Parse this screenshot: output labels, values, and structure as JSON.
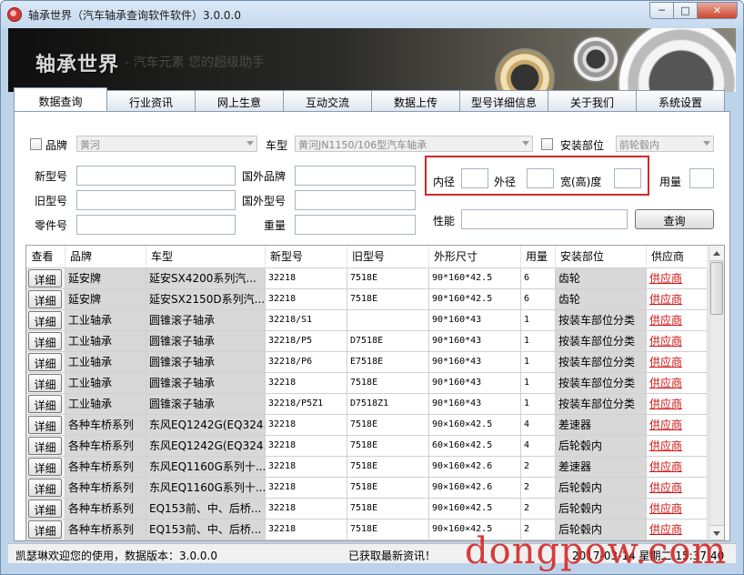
{
  "window": {
    "title": "轴承世界（汽车轴承查询软件软件）3.0.0.0",
    "min_glyph": "─",
    "max_glyph": "□",
    "close_glyph": "✕"
  },
  "banner": {
    "brand": "轴承世界",
    "slogan": "- 汽车元素 您的超级助手"
  },
  "tabs": [
    "数据查询",
    "行业资讯",
    "网上生意",
    "互动交流",
    "数据上传",
    "型号详细信息",
    "关于我们",
    "系统设置"
  ],
  "filters": {
    "brand_label": "品牌",
    "brand_value": "黄河",
    "car_label": "车型",
    "car_value": "黄河JN1150/106型汽车轴承",
    "install_label": "安装部位",
    "install_value": "前轮毂内",
    "new_model_label": "新型号",
    "old_model_label": "旧型号",
    "part_no_label": "零件号",
    "foreign_brand_label": "国外品牌",
    "foreign_model_label": "国外型号",
    "weight_label": "重量",
    "inner_label": "内径",
    "outer_label": "外径",
    "width_label": "宽(高)度",
    "usage_label": "用量",
    "perf_label": "性能",
    "query_button": "查询"
  },
  "grid": {
    "columns": [
      "查看",
      "品牌",
      "车型",
      "新型号",
      "旧型号",
      "外形尺寸",
      "用量",
      "安装部位",
      "供应商"
    ],
    "detail_label": "详细",
    "rows": [
      {
        "brand": "延安牌",
        "car": "延安SX4200系列汽...",
        "new": "32218",
        "old": "7518E",
        "size": "90*160*42.5",
        "qty": "6",
        "pos": "齿轮",
        "vendor": "供应商"
      },
      {
        "brand": "延安牌",
        "car": "延安SX2150D系列汽...",
        "new": "32218",
        "old": "7518E",
        "size": "90*160*42.5",
        "qty": "6",
        "pos": "齿轮",
        "vendor": "供应商"
      },
      {
        "brand": "工业轴承",
        "car": "圆锥滚子轴承",
        "new": "32218/S1",
        "old": "",
        "size": "90*160*43",
        "qty": "1",
        "pos": "按装车部位分类",
        "vendor": "供应商"
      },
      {
        "brand": "工业轴承",
        "car": "圆锥滚子轴承",
        "new": "32218/P5",
        "old": "D7518E",
        "size": "90*160*43",
        "qty": "1",
        "pos": "按装车部位分类",
        "vendor": "供应商"
      },
      {
        "brand": "工业轴承",
        "car": "圆锥滚子轴承",
        "new": "32218/P6",
        "old": "E7518E",
        "size": "90*160*43",
        "qty": "1",
        "pos": "按装车部位分类",
        "vendor": "供应商"
      },
      {
        "brand": "工业轴承",
        "car": "圆锥滚子轴承",
        "new": "32218",
        "old": "7518E",
        "size": "90*160*43",
        "qty": "1",
        "pos": "按装车部位分类",
        "vendor": "供应商"
      },
      {
        "brand": "工业轴承",
        "car": "圆锥滚子轴承",
        "new": "32218/P5Z1",
        "old": "D7518Z1",
        "size": "90*160*43",
        "qty": "1",
        "pos": "按装车部位分类",
        "vendor": "供应商"
      },
      {
        "brand": "各种车桥系列",
        "car": "东风EQ1242G(EQ324...",
        "new": "32218",
        "old": "7518E",
        "size": "90×160×42.5",
        "qty": "4",
        "pos": "差速器",
        "vendor": "供应商"
      },
      {
        "brand": "各种车桥系列",
        "car": "东风EQ1242G(EQ324...",
        "new": "32218",
        "old": "7518E",
        "size": "60×160×42.5",
        "qty": "4",
        "pos": "后轮毂内",
        "vendor": "供应商"
      },
      {
        "brand": "各种车桥系列",
        "car": "东风EQ1160G系列十...",
        "new": "32218",
        "old": "7518E",
        "size": "90×160×42.6",
        "qty": "2",
        "pos": "差速器",
        "vendor": "供应商"
      },
      {
        "brand": "各种车桥系列",
        "car": "东风EQ1160G系列十...",
        "new": "32218",
        "old": "7518E",
        "size": "90×160×42.6",
        "qty": "2",
        "pos": "后轮毂内",
        "vendor": "供应商"
      },
      {
        "brand": "各种车桥系列",
        "car": "EQ153前、中、后桥...",
        "new": "32218",
        "old": "7518E",
        "size": "90×160×42.5",
        "qty": "2",
        "pos": "后轮毂内",
        "vendor": "供应商"
      },
      {
        "brand": "各种车桥系列",
        "car": "EQ153前、中、后桥...",
        "new": "32218",
        "old": "7518E",
        "size": "90×160×42.5",
        "qty": "2",
        "pos": "后轮毂内",
        "vendor": "供应商"
      }
    ]
  },
  "status": {
    "welcome": "凯瑟琳欢迎您的使用，数据版本：3.0.0.0",
    "news": "已获取最新资讯！",
    "datetime": "2017-03-14 星期二 15:37:40"
  },
  "watermark": "dongpow.com"
}
